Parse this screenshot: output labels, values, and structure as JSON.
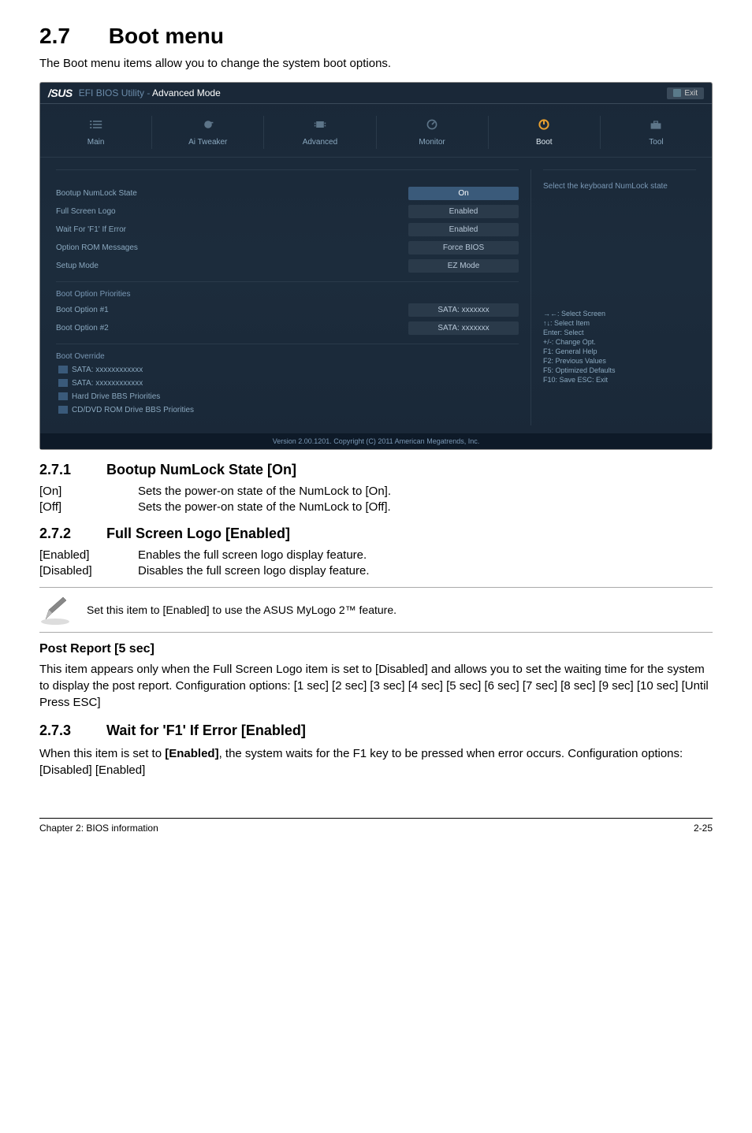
{
  "section": {
    "number": "2.7",
    "title": "Boot menu",
    "description": "The Boot menu items allow you to change the system boot options."
  },
  "bios": {
    "brand": "/SUS",
    "header_title": "EFI BIOS Utility - ",
    "header_mode": "Advanced Mode",
    "exit": "Exit",
    "tabs": {
      "main": "Main",
      "tweaker": "Ai  Tweaker",
      "advanced": "Advanced",
      "monitor": "Monitor",
      "boot": "Boot",
      "tool": "Tool"
    },
    "settings": {
      "numlock": {
        "label": "Bootup NumLock State",
        "value": "On"
      },
      "fullscreen": {
        "label": "Full Screen Logo",
        "value": "Enabled"
      },
      "waitf1": {
        "label": "Wait For 'F1' If Error",
        "value": "Enabled"
      },
      "optionrom": {
        "label": "Option ROM Messages",
        "value": "Force BIOS"
      },
      "setupmode": {
        "label": "Setup Mode",
        "value": "EZ Mode"
      }
    },
    "bootpriority": {
      "header": "Boot Option Priorities",
      "opt1": {
        "label": "Boot Option #1",
        "value": "SATA: xxxxxxx"
      },
      "opt2": {
        "label": "Boot Option #2",
        "value": "SATA: xxxxxxx"
      }
    },
    "override": {
      "header": "Boot Override",
      "sata1": "SATA: xxxxxxxxxxxx",
      "sata2": "SATA: xxxxxxxxxxxx",
      "hdd": "Hard Drive BBS Priorities",
      "cddvd": "CD/DVD ROM Drive BBS Priorities"
    },
    "sidebar": {
      "hint": "Select the keyboard NumLock state",
      "help": {
        "l1": "→←:  Select Screen",
        "l2": "↑↓:  Select Item",
        "l3": "Enter:  Select",
        "l4": "+/-:  Change Opt.",
        "l5": "F1:  General Help",
        "l6": "F2:  Previous Values",
        "l7": "F5:  Optimized Defaults",
        "l8": "F10:  Save    ESC:  Exit"
      }
    },
    "footer": "Version  2.00.1201.   Copyright  (C)  2011 American  Megatrends,  Inc."
  },
  "sub271": {
    "number": "2.7.1",
    "title": "Bootup NumLock State [On]",
    "on_key": "[On]",
    "on_val": "Sets the power-on state of the NumLock to [On].",
    "off_key": "[Off]",
    "off_val": "Sets the power-on state of the NumLock to [Off]."
  },
  "sub272": {
    "number": "2.7.2",
    "title": "Full Screen Logo [Enabled]",
    "en_key": "[Enabled]",
    "en_val": "Enables the full screen logo display feature.",
    "dis_key": "[Disabled]",
    "dis_val": "Disables the full screen logo display feature.",
    "note": "Set this item to [Enabled] to use the ASUS MyLogo 2™ feature."
  },
  "postreport": {
    "title": "Post Report [5 sec]",
    "body": "This item appears only when the Full Screen Logo item is set to [Disabled] and allows you to set the waiting time for the system to display the post report. Configuration options: [1 sec] [2 sec] [3 sec] [4 sec] [5 sec] [6 sec] [7 sec] [8 sec] [9 sec] [10 sec] [Until Press ESC]"
  },
  "sub273": {
    "number": "2.7.3",
    "title": "Wait for 'F1' If Error [Enabled]",
    "body_pre": "When this item is set to ",
    "body_bold": "[Enabled]",
    "body_post": ", the system waits for the F1 key to be pressed when error occurs. Configuration options: [Disabled] [Enabled]"
  },
  "footer": {
    "chapter": "Chapter 2: BIOS information",
    "page": "2-25"
  }
}
